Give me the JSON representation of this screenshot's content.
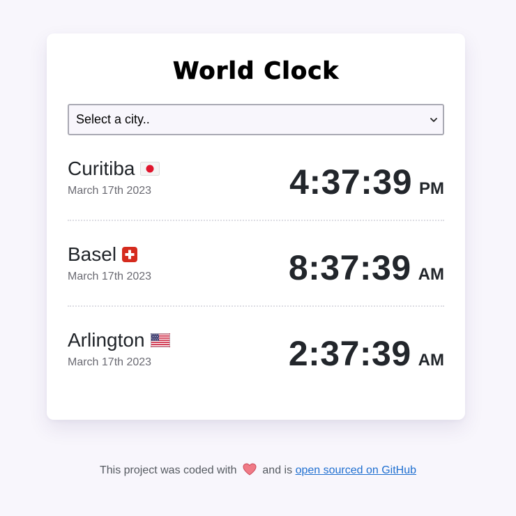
{
  "app": {
    "title": "World Clock"
  },
  "search": {
    "placeholder": "Select a city.."
  },
  "cities": [
    {
      "name": "Curitiba",
      "flag_icon": "japan-flag-icon",
      "date": "March 17th 2023",
      "time": "4:37:39",
      "ampm": "PM"
    },
    {
      "name": "Basel",
      "flag_icon": "switzerland-flag-icon",
      "date": "March 17th 2023",
      "time": "8:37:39",
      "ampm": "AM"
    },
    {
      "name": "Arlington",
      "flag_icon": "usa-flag-icon",
      "date": "March 17th 2023",
      "time": "2:37:39",
      "ampm": "AM"
    }
  ],
  "footer": {
    "prefix": "This project was coded with",
    "heart_icon": "heart-icon",
    "middle": "and is",
    "link_text": "open sourced on GitHub"
  },
  "colors": {
    "background": "#f8f6fc",
    "card": "#ffffff",
    "link": "#1f6fd0",
    "time_text": "#22262b"
  }
}
